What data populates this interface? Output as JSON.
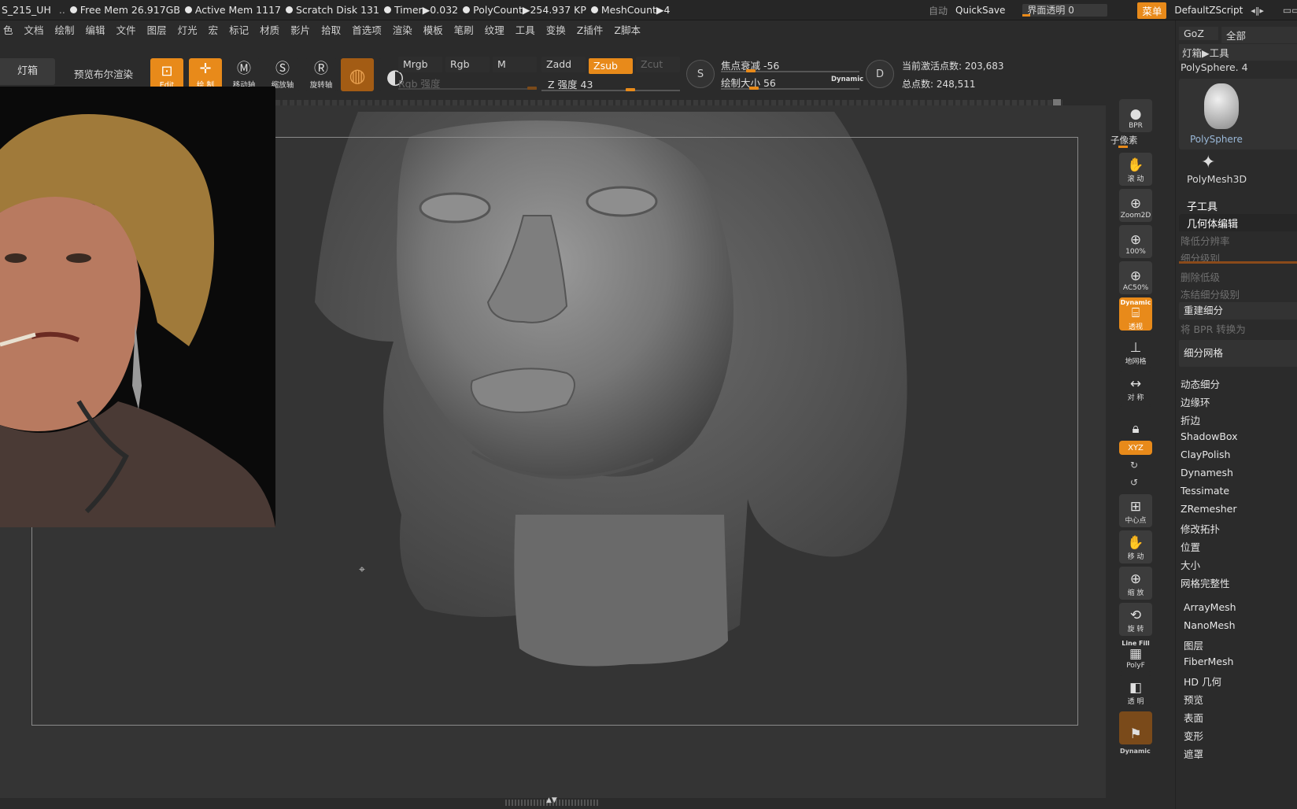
{
  "status": {
    "doc": "S_215_UH",
    "free_mem": "Free Mem 26.917GB",
    "active_mem": "Active Mem 1117",
    "scratch": "Scratch Disk 131",
    "timer": "Timer▶0.032",
    "polycount": "PolyCount▶254.937 KP",
    "meshcount": "MeshCount▶4",
    "auto": "自动",
    "quicksave": "QuickSave",
    "ui_transparency": "界面透明 0",
    "menu": "菜单",
    "script": "DefaultZScript"
  },
  "menubar": [
    "色",
    "文档",
    "绘制",
    "编辑",
    "文件",
    "图层",
    "灯光",
    "宏",
    "标记",
    "材质",
    "影片",
    "拾取",
    "首选项",
    "渲染",
    "模板",
    "笔刷",
    "纹理",
    "工具",
    "变换",
    "Z插件",
    "Z脚本"
  ],
  "row2": "2",
  "toolbar": {
    "lightbox": "灯箱",
    "preview_bpr": "预览布尔渲染",
    "edit": "Edit",
    "draw": "绘 制",
    "move": "移动轴",
    "scale": "缩放轴",
    "rotate": "旋转轴",
    "mrgb": "Mrgb",
    "rgb": "Rgb",
    "m": "M",
    "rgb_intensity": "Rgb 强度",
    "zadd": "Zadd",
    "zsub": "Zsub",
    "zcut": "Zcut",
    "z_intensity": "Z 强度 43",
    "focal_shift": "焦点衰减 -56",
    "draw_size": "绘制大小 56",
    "dynamic": "Dynamic",
    "active_points": "当前激活点数: 203,683",
    "total_points": "总点数: 248,511",
    "s_label": "S",
    "d_label": "D"
  },
  "shelf": {
    "bpr": "BPR",
    "subpixel": "子像素",
    "scroll": "滚 动",
    "zoom2d": "Zoom2D",
    "z100": "100%",
    "ac50": "AC50%",
    "dynamic": "Dynamic",
    "persp": "透视",
    "floor": "地网格",
    "sym": "对 称",
    "lock": "",
    "xyz": "XYZ",
    "center": "中心点",
    "move": "移 动",
    "zoom": "缩 放",
    "rotate": "旋 转",
    "linefill": "Line Fill",
    "polyf": "PolyF",
    "transp": "透 明",
    "dynamic2": "Dynamic"
  },
  "palette": {
    "goz": "GoZ",
    "all": "全部",
    "lightbox_tool": "灯箱▶工具",
    "polysphere_top": "PolySphere. 4",
    "polysphere": "PolySphere",
    "polymesh3d": "PolyMesh3D",
    "subtool": "子工具",
    "geometry": "几何体编辑",
    "lower_res": "降低分辨率",
    "sdiv": "细分级别",
    "del_lower": "删除低级",
    "freeze": "冻结细分级别",
    "reconstruct": "重建细分",
    "bpr_convert": "将 BPR 转换为",
    "divide": "细分网格",
    "dynamic_sub": "动态细分",
    "edgeloop": "边缘环",
    "crease": "折边",
    "shadowbox": "ShadowBox",
    "claypolish": "ClayPolish",
    "dynamesh": "Dynamesh",
    "tessimate": "Tessimate",
    "zremesher": "ZRemesher",
    "modify_topo": "修改拓扑",
    "position": "位置",
    "size": "大小",
    "mesh_integrity": "网格完整性",
    "arraymesh": "ArrayMesh",
    "nanomesh": "NanoMesh",
    "layers": "图层",
    "fibermesh": "FiberMesh",
    "hd_geo": "HD 几何",
    "preview": "预览",
    "surface": "表面",
    "deform": "变形",
    "masking": "遮罩"
  }
}
